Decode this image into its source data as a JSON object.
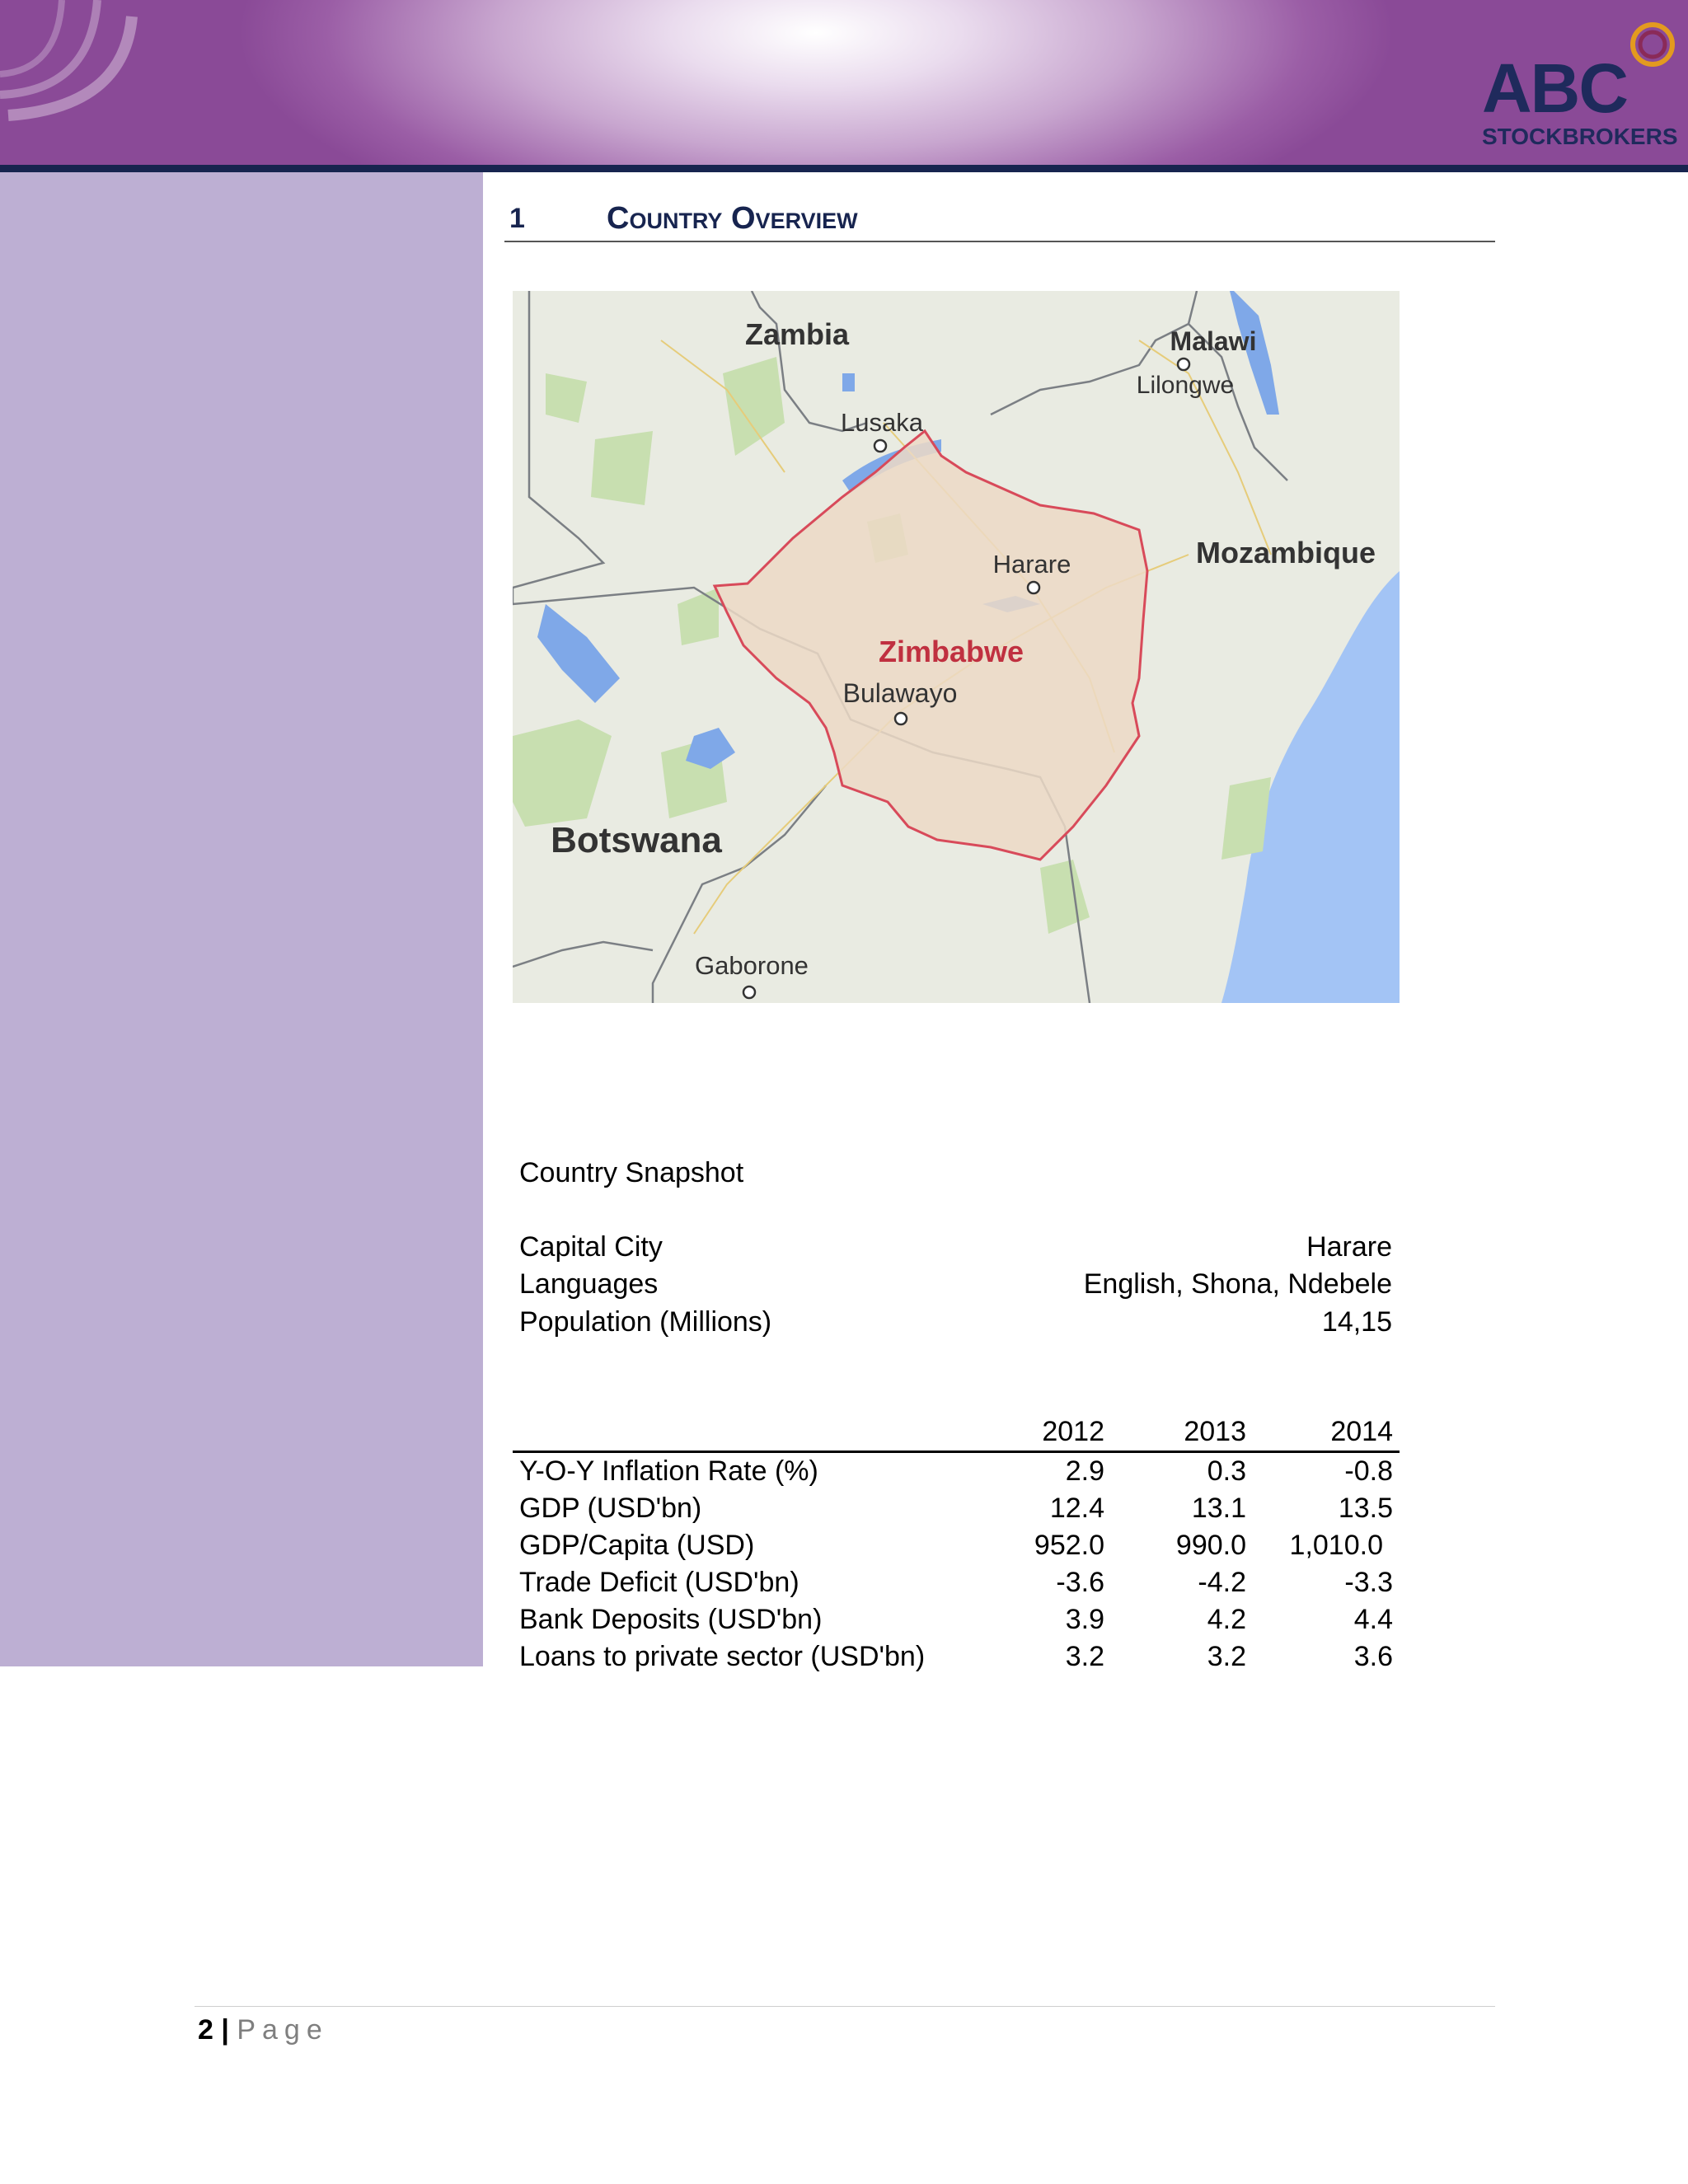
{
  "brand": {
    "name": "ABC",
    "subtitle": "STOCKBROKERS",
    "colors": {
      "banner": "#8a4a97",
      "navy": "#17244f",
      "side_panel": "#bdafd3",
      "logo_ring": "#e39a1f"
    }
  },
  "section": {
    "number": "1",
    "title": "Country Overview"
  },
  "map": {
    "labels": {
      "zambia": "Zambia",
      "lusaka": "Lusaka",
      "malawi": "Malawi",
      "lilongwe": "Lilongwe",
      "mozambique": "Mozambique",
      "harare": "Harare",
      "zimbabwe": "Zimbabwe",
      "bulawayo": "Bulawayo",
      "botswana": "Botswana",
      "gaborone": "Gaborone"
    }
  },
  "snapshot": {
    "title": "Country Snapshot",
    "facts": [
      {
        "label": "Capital City",
        "value": "Harare"
      },
      {
        "label": "Languages",
        "value": "English, Shona, Ndebele"
      },
      {
        "label": "Population (Millions)",
        "value": "14,15"
      }
    ]
  },
  "indicators": {
    "years": [
      "2012",
      "2013",
      "2014"
    ],
    "rows": [
      {
        "label": "Y-O-Y Inflation Rate (%)",
        "values": [
          "2.9",
          "0.3",
          "-0.8"
        ]
      },
      {
        "label": "GDP (USD'bn)",
        "values": [
          "12.4",
          "13.1",
          "13.5"
        ]
      },
      {
        "label": "GDP/Capita (USD)",
        "values": [
          "952.0",
          "990.0",
          "1,010.0"
        ]
      },
      {
        "label": "Trade Deficit (USD'bn)",
        "values": [
          "-3.6",
          "-4.2",
          "-3.3"
        ]
      },
      {
        "label": "Bank Deposits (USD'bn)",
        "values": [
          "3.9",
          "4.2",
          "4.4"
        ]
      },
      {
        "label": "Loans to private sector (USD'bn)",
        "values": [
          "3.2",
          "3.2",
          "3.6"
        ]
      }
    ]
  },
  "footer": {
    "page_number": "2",
    "separator": "|",
    "page_word": "Page"
  }
}
